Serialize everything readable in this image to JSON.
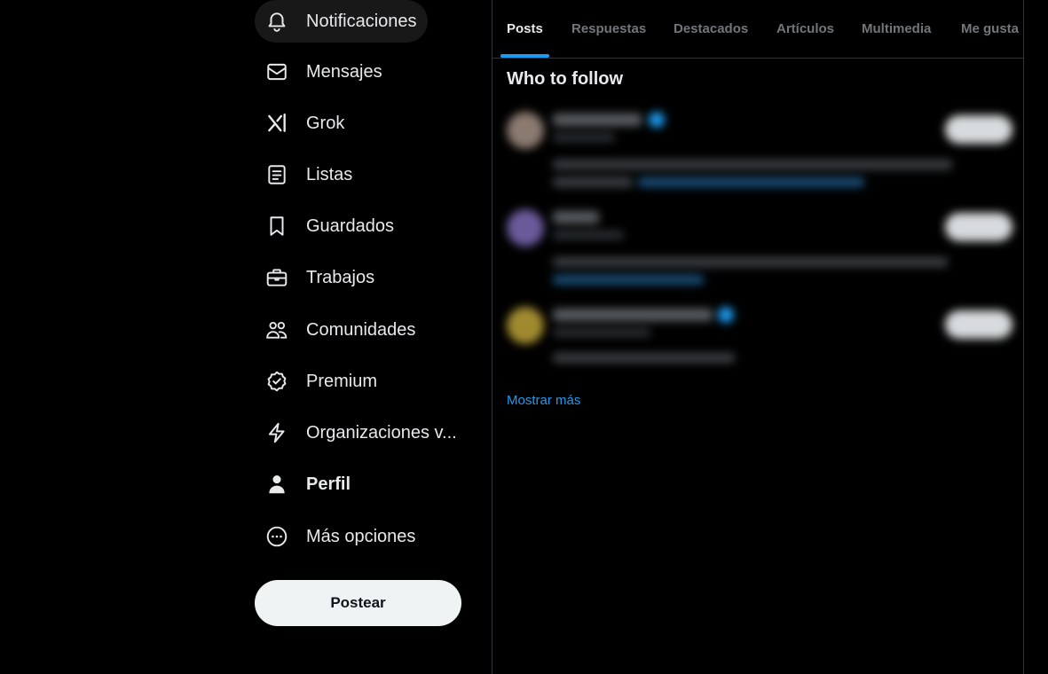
{
  "nav": {
    "items": [
      {
        "label": "Notificaciones",
        "icon": "bell-icon"
      },
      {
        "label": "Mensajes",
        "icon": "envelope-icon"
      },
      {
        "label": "Grok",
        "icon": "grok-icon"
      },
      {
        "label": "Listas",
        "icon": "list-icon"
      },
      {
        "label": "Guardados",
        "icon": "bookmark-icon"
      },
      {
        "label": "Trabajos",
        "icon": "briefcase-icon"
      },
      {
        "label": "Comunidades",
        "icon": "communities-icon"
      },
      {
        "label": "Premium",
        "icon": "verified-badge-icon"
      },
      {
        "label": "Organizaciones v...",
        "icon": "lightning-icon"
      },
      {
        "label": "Perfil",
        "icon": "person-icon"
      },
      {
        "label": "Más opciones",
        "icon": "more-circle-icon"
      }
    ],
    "post_button": "Postear"
  },
  "tabs": [
    "Posts",
    "Respuestas",
    "Destacados",
    "Artículos",
    "Multimedia",
    "Me gusta"
  ],
  "who_to_follow": {
    "title": "Who to follow",
    "show_more": "Mostrar más"
  },
  "colors": {
    "accent": "#1d9bf0",
    "background": "#000000",
    "text": "#e7e9ea",
    "muted": "#71767b",
    "border": "#2f3336",
    "post_button_bg": "#eff3f4"
  }
}
